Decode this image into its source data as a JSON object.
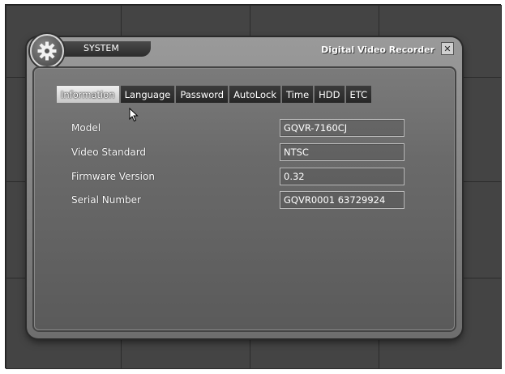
{
  "window": {
    "tab_label": "SYSTEM",
    "title": "Digital Video Recorder",
    "close_symbol": "✕"
  },
  "tabs": [
    {
      "label": "Information",
      "active": true
    },
    {
      "label": "Language",
      "active": false
    },
    {
      "label": "Password",
      "active": false
    },
    {
      "label": "AutoLock",
      "active": false
    },
    {
      "label": "Time",
      "active": false
    },
    {
      "label": "HDD",
      "active": false
    },
    {
      "label": "ETC",
      "active": false
    }
  ],
  "info": [
    {
      "label": "Model",
      "value": "GQVR-7160CJ"
    },
    {
      "label": "Video Standard",
      "value": "NTSC"
    },
    {
      "label": "Firmware Version",
      "value": "0.32"
    },
    {
      "label": "Serial Number",
      "value": "GQVR0001 63729924"
    }
  ],
  "icons": {
    "settings": "gear-icon",
    "close": "close-icon",
    "pointer": "mouse-cursor-icon"
  },
  "colors": {
    "background": "#3a3a3a",
    "dialog": "#6a6a6a",
    "text": "#ffffff"
  }
}
